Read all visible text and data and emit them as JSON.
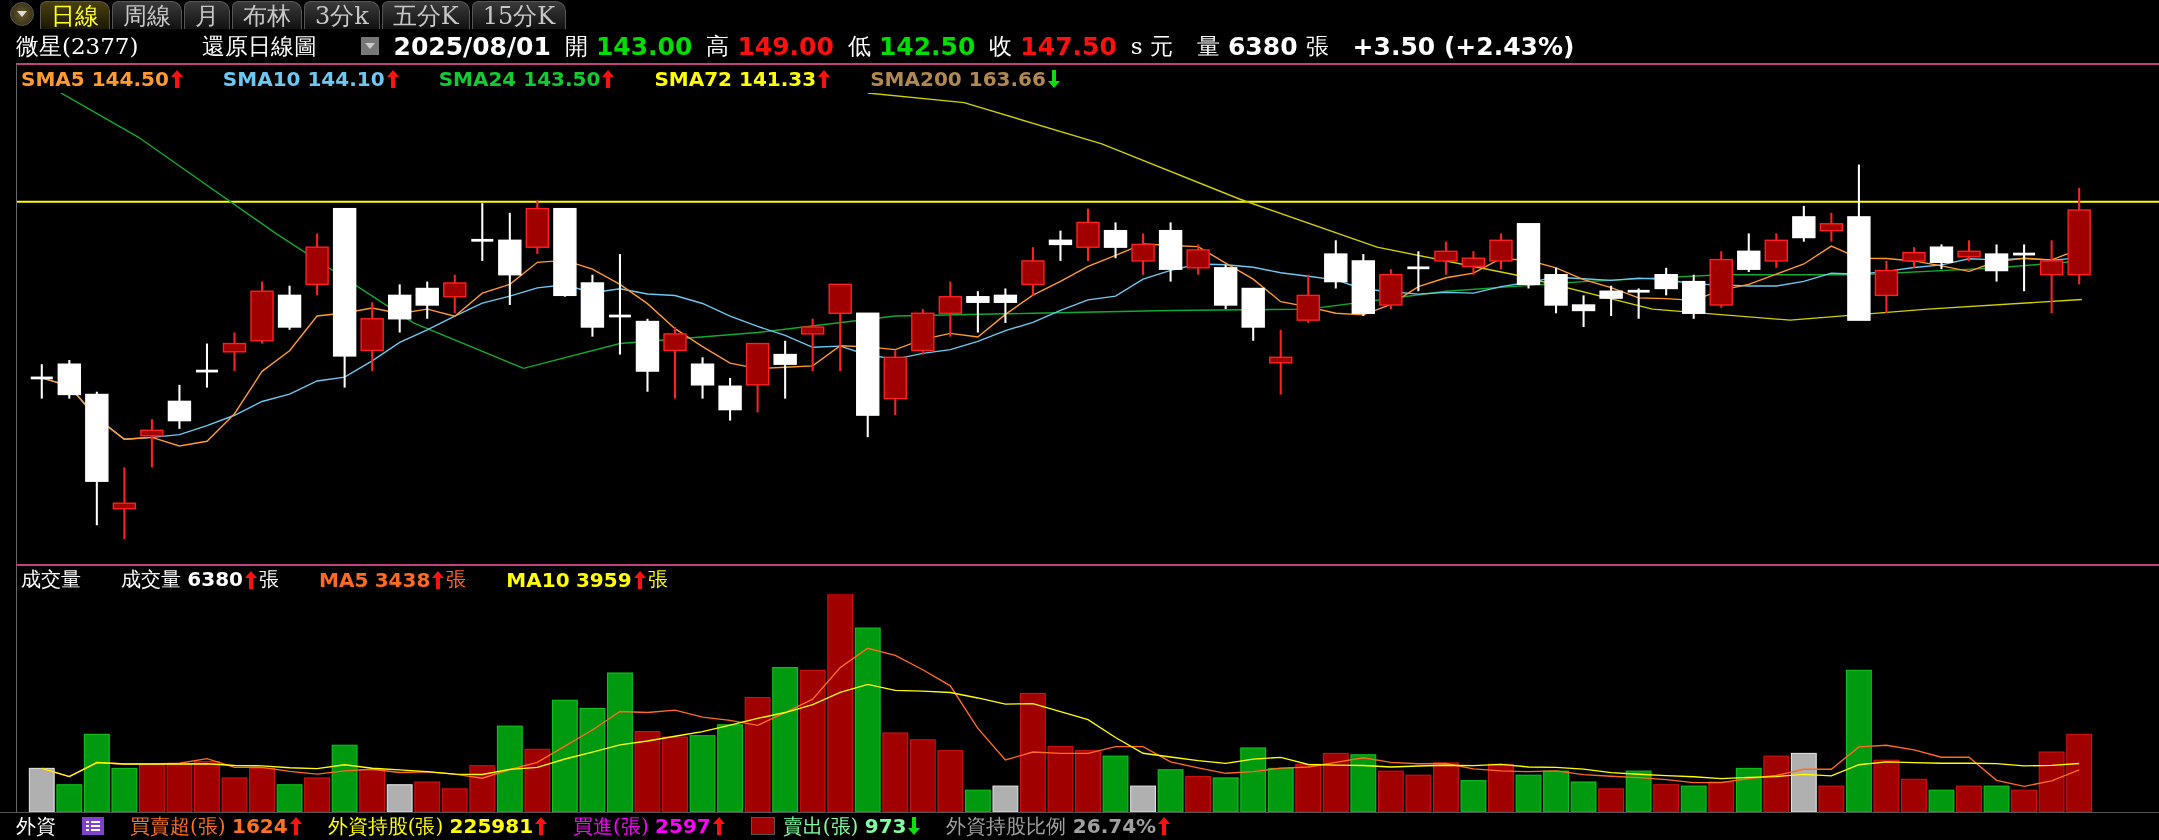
{
  "tabs": [
    {
      "label": "日線",
      "selected": true
    },
    {
      "label": "周線",
      "selected": false
    },
    {
      "label": "月",
      "selected": false
    },
    {
      "label": "布林",
      "selected": false
    },
    {
      "label": "3分k",
      "selected": false
    },
    {
      "label": "五分K",
      "selected": false
    },
    {
      "label": "15分K",
      "selected": false
    }
  ],
  "quote": {
    "stock": "微星(2377)",
    "chart_type": "還原日線圖",
    "date": "2025/08/01",
    "fields": [
      {
        "label": "開",
        "value": "143.00",
        "color": "#00dd00"
      },
      {
        "label": "高",
        "value": "149.00",
        "color": "#ff1010"
      },
      {
        "label": "低",
        "value": "142.50",
        "color": "#00dd00"
      },
      {
        "label": "收",
        "value": "147.50",
        "color": "#ff1010"
      }
    ],
    "unit": "s 元",
    "volume_label": "量",
    "volume": "6380",
    "volume_unit": "張",
    "change": "+3.50 (+2.43%)"
  },
  "price_legend": [
    {
      "label": "SMA5",
      "value": "144.50",
      "color": "#ff9a30",
      "kind": "up"
    },
    {
      "label": "SMA10",
      "value": "144.10",
      "color": "#6cc8f0",
      "kind": "up"
    },
    {
      "label": "SMA24",
      "value": "143.50",
      "color": "#10cc30",
      "kind": "up"
    },
    {
      "label": "SMA72",
      "value": "141.33",
      "color": "#ffff00",
      "kind": "up"
    },
    {
      "label": "SMA200",
      "value": "163.66",
      "color": "#b08850",
      "kind": "down"
    }
  ],
  "volume_panel": {
    "title": "成交量",
    "legend": [
      {
        "label": "成交量",
        "value": "6380",
        "unit": "張",
        "color": "#ffffff",
        "kind": "up"
      },
      {
        "label": "MA5",
        "value": "3438",
        "unit": "張",
        "color": "#ff6a20",
        "kind": "up"
      },
      {
        "label": "MA10",
        "value": "3959",
        "unit": "張",
        "color": "#ffff00",
        "kind": "up"
      }
    ]
  },
  "foreign": {
    "title": "外資",
    "items": [
      {
        "label": "買賣超(張)",
        "value": "1624",
        "color": "#ff7020",
        "kind": "up",
        "swatch": false
      },
      {
        "label": "外資持股(張)",
        "value": "225981",
        "color": "#ffff00",
        "kind": "up",
        "swatch": false
      },
      {
        "label": "買進(張)",
        "value": "2597",
        "color": "#ff00ff",
        "kind": "up",
        "swatch": false
      },
      {
        "label": "賣出(張)",
        "value": "973",
        "color": "#80ffa0",
        "kind": "down",
        "swatch": true
      },
      {
        "label": "外資持股比例",
        "value": "26.74%",
        "color": "#a0a0a0",
        "kind": "up",
        "swatch": false
      }
    ]
  }
}
